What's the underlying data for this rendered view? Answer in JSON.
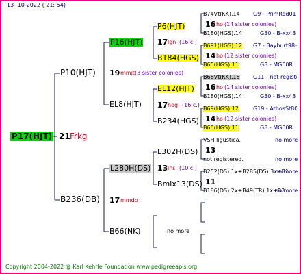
{
  "header": {
    "date": "13- 10-2022 ( 21: 54)"
  },
  "footer": {
    "copyright": "Copyright 2004-2022 @ Karl Kehrle Foundation   www.pedigreeapis.org"
  },
  "root": {
    "label": "P17(HJT)",
    "count": "21",
    "name": "Frkg"
  },
  "gen1": [
    {
      "label": "P10(HJT)",
      "count": "19",
      "name": "mmjt",
      "siblings": "(3 sister colonies)"
    },
    {
      "label": "B236(DB)",
      "count": "17",
      "name": "mmdb"
    }
  ],
  "gen2": [
    {
      "label": "P16(HJT)",
      "count": "17",
      "name": "lgn",
      "siblings": "(16 c.)"
    },
    {
      "label": "EL8(HJT)",
      "count": "17",
      "name": "hog",
      "siblings": "(16 c.)"
    },
    {
      "label": "L280H(DS)",
      "count": "13",
      "name": "ins",
      "siblings": "(10 c.)"
    },
    {
      "label": "B66(NK)",
      "note": "no more"
    }
  ],
  "gen3": [
    {
      "label": "P6(HJT)",
      "count": "17",
      "name": "lgn",
      "siblings": "(16 c.)"
    },
    {
      "label": "B184(HGS)"
    },
    {
      "label": "EL12(HJT)",
      "count": "17",
      "name": "hog",
      "siblings": "(16 c.)"
    },
    {
      "label": "B234(HGS)"
    },
    {
      "label": "L302H(DS)"
    },
    {
      "label": "Bmix13(DS)"
    }
  ],
  "gen4": [
    {
      "top": "B74Vt(KK).14",
      "topnote": "G9 - PrimRed01",
      "count": "16",
      "name": "ho",
      "siblings": "(14 sister colonies)",
      "bottom": "B180(HGS).14",
      "bottomnote": "G30 - B-xx43"
    },
    {
      "top": "B691(HGS).12",
      "topnote": "G7 - Bayburt98-3",
      "count": "14",
      "name": "ho",
      "siblings": "(12 sister colonies)",
      "bottom": "B65(HGS).11",
      "bottomnote": "G8 - MG00R"
    },
    {
      "top": "B66Vt(KK).15",
      "topnote": "G11 - not registe",
      "count": "16",
      "name": "ho",
      "siblings": "(14 sister colonies)",
      "bottom": "B180(HGS).14",
      "bottomnote": "G30 - B-xx43"
    },
    {
      "top": "B69(HGS).12",
      "topnote": "G19 - AthosSt80R",
      "count": "14",
      "name": "ho",
      "siblings": "(12 sister colonies)",
      "bottom": "B65(HGS).11",
      "bottomnote": "G8 - MG00R"
    },
    {
      "top": "VSH ligustica.",
      "topnote": "no more",
      "count": "13",
      "bottom": "not registered.",
      "bottomnote": "no more"
    },
    {
      "top": "B252(DS).1x+B285(DS).3x+B1",
      "topnote": "no more",
      "count": "11",
      "bottom": "B186(DS).2x+B49(TR).1x+B2",
      "bottomnote": "no more"
    }
  ],
  "colors": {
    "border": "#e6007e",
    "line": "#1a1a5e",
    "yellow": "#ffff00",
    "green": "#00d600",
    "gray": "#c8c8c8"
  }
}
